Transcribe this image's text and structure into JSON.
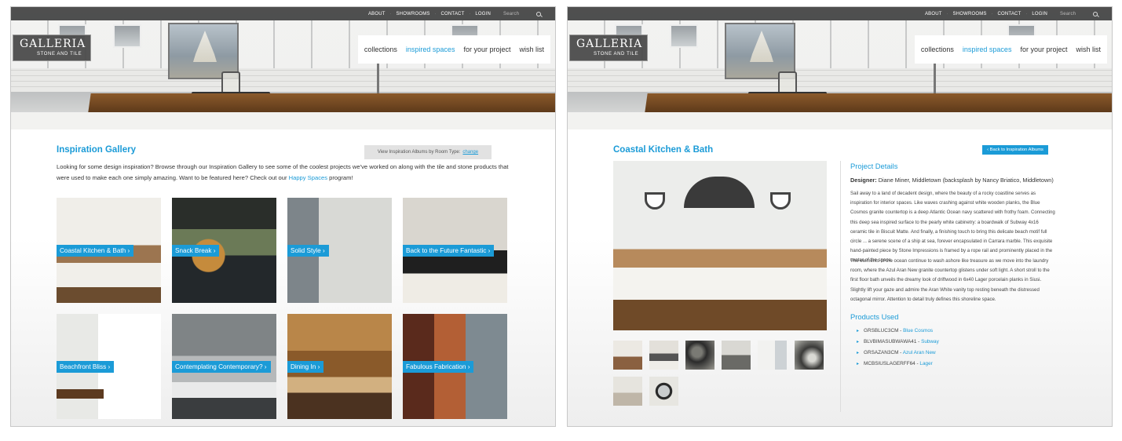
{
  "topnav": {
    "items": [
      "ABOUT",
      "SHOWROOMS",
      "CONTACT",
      "LOGIN"
    ],
    "search_placeholder": "Search"
  },
  "logo": {
    "main": "GALLERIA",
    "sub": "STONE AND TILE"
  },
  "mainnav": {
    "items": [
      "collections",
      "inspired spaces",
      "for your project",
      "wish list"
    ],
    "active_index": 1
  },
  "gallery": {
    "title": "Inspiration Gallery",
    "room_type_label": "View Inspiration Albums by Room Type:",
    "room_type_link": "change",
    "intro_part1": "Looking for some design inspiration? Browse through our Inspiration Gallery to see some of the coolest projects we've worked on along with the tile and stone products that were used to make each one simply amazing. Want to be featured here? Check out our ",
    "intro_link": "Happy Spaces",
    "intro_part2": " program!",
    "tiles": [
      "Coastal Kitchen & Bath",
      "Snack Break",
      "Solid Style",
      "Back to the Future Fantastic",
      "Beachfront Bliss",
      "Contemplating Contemporary?",
      "Dining In",
      "Fabulous Fabrication"
    ]
  },
  "detail": {
    "title": "Coastal Kitchen & Bath",
    "back_button": "Back to Inspiration Albums",
    "project_details_heading": "Project Details",
    "designer_label": "Designer:",
    "designer_value": "Diane Miner, Middletown (backsplash by Nancy Briatico, Middletown)",
    "paragraph1": "Sail away to a land of decadent design, where the beauty of a rocky coastline serves as inspiration for interior spaces. Like waves crashing against white wooden planks, the Blue Cosmos granite countertop is a deep Atlantic Ocean navy scattered with frothy foam. Connecting this deep sea inspired surface to the pearly white cabinetry: a boardwalk of Subway 4x16 ceramic tile in Biscuit Matte. And finally, a finishing touch to bring this delicate beach motif full circle ... a serene scene of a ship at sea, forever encapsulated in Carrara marble. This exquisite hand-painted piece by Stone Impressions is framed by a rope rail and prominently placed in the center of the space.",
    "paragraph2": "The elements of the ocean continue to wash ashore like treasure as we move into the laundry room, where the Azul Aran New granite countertop glistens under soft light. A short stroll to the first floor bath unveils the dreamy look of driftwood in 6x40 Lager porcelain planks in Siusi. Slightly lift your gaze and admire the Aran White vanity top resting beneath the distressed octagonal mirror. Attention to detail truly defines this shoreline space.",
    "products_heading": "Products Used",
    "products": [
      {
        "code": "GRSBLUC3CM",
        "name": "Blue Cosmos"
      },
      {
        "code": "BLVBIMASUBWAWA41",
        "name": "Subway"
      },
      {
        "code": "GRSAZAN3CM",
        "name": "Azul Aran New"
      },
      {
        "code": "MCBSIUSLAGERFF64",
        "name": "Lager"
      }
    ]
  },
  "colors": {
    "accent": "#1b9bd7"
  }
}
